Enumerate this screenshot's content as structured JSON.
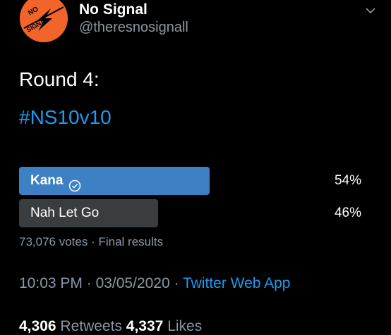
{
  "colors": {
    "background": "#000000",
    "accent": "#1d9bf0",
    "muted": "#8b98a5",
    "winner_bar": "#3d80c4",
    "loser_bar": "#3a3d40",
    "avatar_bg": "#f2652a"
  },
  "tweet": {
    "author": {
      "name": "No Signal",
      "handle": "@theresnosignall",
      "avatar_text_top": "NO",
      "avatar_text_bottom": "SIGNAL",
      "avatar_icon": "lightning-bolt-icon"
    },
    "menu_icon": "chevron-down-icon",
    "text_line_1": "Round 4:",
    "text_line_2": "#NS10v10",
    "poll": {
      "options": [
        {
          "label": "Kana",
          "percent_text": "54%",
          "percent": 54,
          "winner": true,
          "winner_icon": "check-circle-icon"
        },
        {
          "label": "Nah Let Go",
          "percent_text": "46%",
          "percent": 46,
          "winner": false
        }
      ],
      "votes_text": "73,076 votes",
      "separator": " · ",
      "status_text": "Final results"
    },
    "time": "10:03 PM",
    "date": "03/05/2020",
    "dot": " · ",
    "source": "Twitter Web App",
    "retweets_count": "4,306",
    "retweets_label": "Retweets",
    "likes_count": "4,337",
    "likes_label": "Likes"
  }
}
